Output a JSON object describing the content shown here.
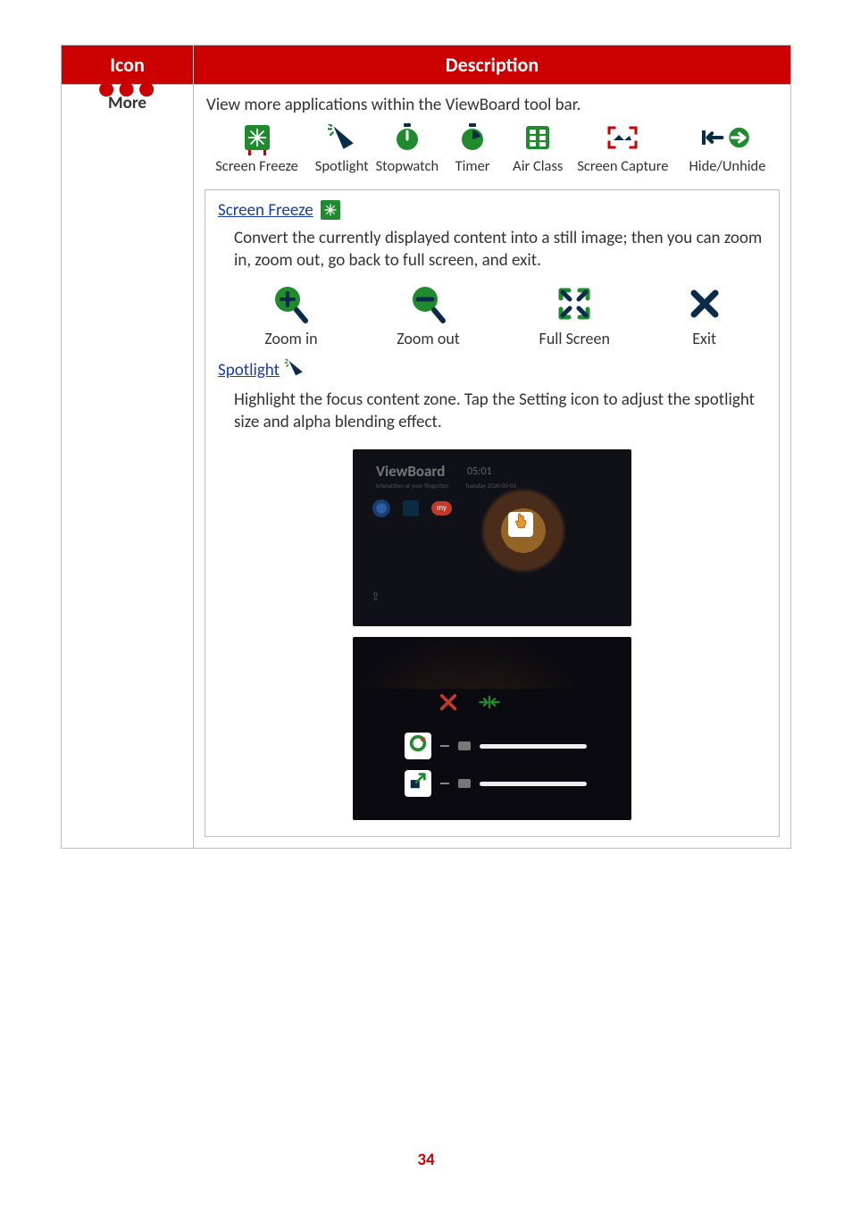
{
  "headers": {
    "icon": "Icon",
    "description": "Description"
  },
  "row": {
    "icon_label": "More",
    "intro": "View more applications within the ViewBoard tool bar.",
    "toolbar": [
      {
        "key": "screen-freeze",
        "label": "Screen Freeze"
      },
      {
        "key": "spotlight",
        "label": "Spotlight"
      },
      {
        "key": "stopwatch",
        "label": "Stopwatch"
      },
      {
        "key": "timer",
        "label": "Timer"
      },
      {
        "key": "air-class",
        "label": "Air Class"
      },
      {
        "key": "screen-capture",
        "label": "Screen Capture"
      },
      {
        "key": "hide-unhide",
        "label": "Hide/Unhide"
      }
    ],
    "screen_freeze": {
      "title": "Screen Freeze",
      "text": "Convert the currently displayed content into a still image; then you can zoom in, zoom out, go back to full screen, and exit.",
      "controls": {
        "zoom_in": "Zoom in",
        "zoom_out": "Zoom out",
        "full_screen": "Full Screen",
        "exit": "Exit"
      }
    },
    "spotlight": {
      "title": "Spotlight",
      "text": "Highlight the focus content zone. Tap the Setting icon to adjust the spotlight size and alpha blending effect.",
      "screenshot": {
        "brand": "ViewBoard",
        "time": "05:01",
        "caption1": "Interaction at your fingertips",
        "caption2": "Tuesday 2020-03-01",
        "pill": "my"
      }
    }
  },
  "page_number": "34"
}
